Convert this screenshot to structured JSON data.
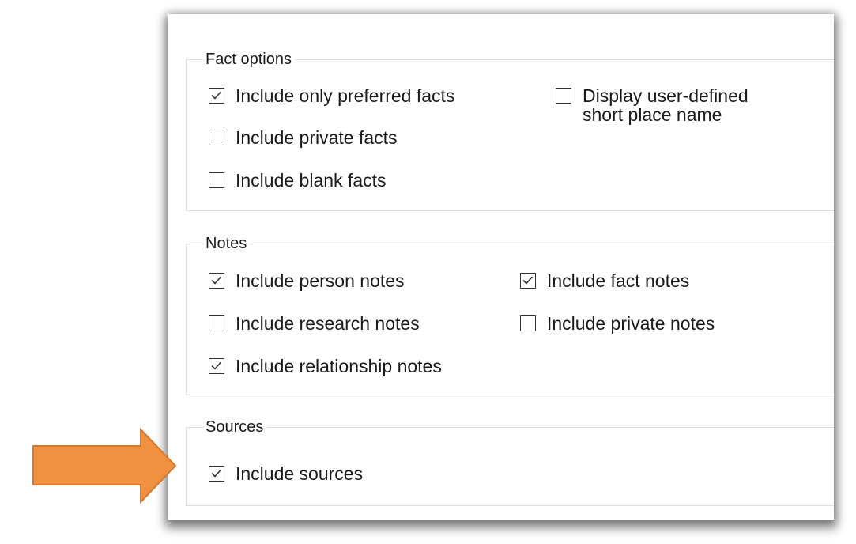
{
  "fact_options": {
    "legend": "Fact options",
    "items": [
      {
        "label": "Include only preferred facts",
        "checked": true
      },
      {
        "label": "Include private facts",
        "checked": false
      },
      {
        "label": "Include blank facts",
        "checked": false
      },
      {
        "label": "Display user-defined\nshort place name",
        "checked": false
      }
    ]
  },
  "notes": {
    "legend": "Notes",
    "items": [
      {
        "label": "Include person notes",
        "checked": true
      },
      {
        "label": "Include research notes",
        "checked": false
      },
      {
        "label": "Include relationship notes",
        "checked": true
      },
      {
        "label": "Include fact notes",
        "checked": true
      },
      {
        "label": "Include private notes",
        "checked": false
      }
    ]
  },
  "sources": {
    "legend": "Sources",
    "items": [
      {
        "label": "Include sources",
        "checked": true
      }
    ]
  },
  "colors": {
    "arrow_fill": "#f0913f",
    "arrow_stroke": "#d9772b",
    "check_mark": "#333333"
  },
  "icons": {
    "arrow": "right-arrow-icon",
    "check": "checkmark-icon"
  }
}
